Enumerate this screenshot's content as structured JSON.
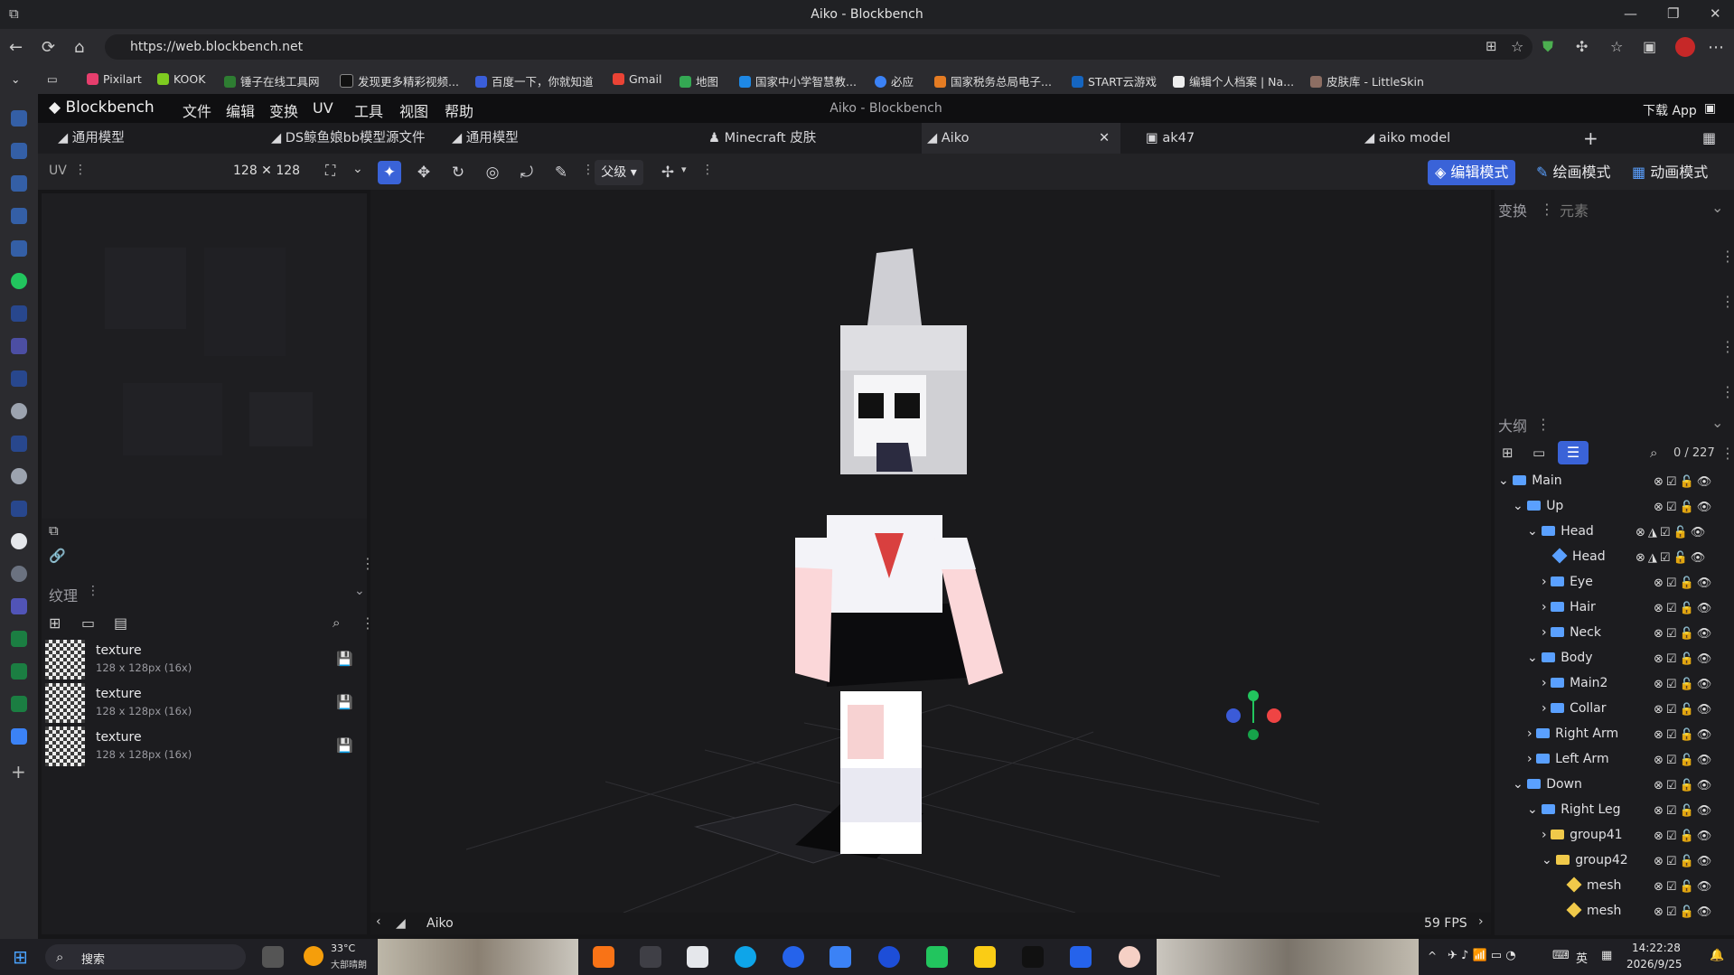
{
  "browser": {
    "window_title": "Aiko - Blockbench",
    "url": "https://web.blockbench.net",
    "bookmarks": [
      "Pixilart",
      "KOOK",
      "锤子在线工具网",
      "发现更多精彩视频...",
      "百度一下，你就知道",
      "Gmail",
      "地图",
      "国家中小学智慧教...",
      "必应",
      "国家税务总局电子...",
      "START云游戏",
      "编辑个人档案 | Na...",
      "皮肤库 - LittleSkin"
    ]
  },
  "menubar": {
    "logo": "Blockbench",
    "items": [
      "文件",
      "编辑",
      "变换",
      "UV",
      "工具",
      "视图",
      "帮助"
    ],
    "center_title": "Aiko - Blockbench",
    "download": "下载 App"
  },
  "tabs": [
    "通用模型",
    "DS鲸鱼娘bb模型源文件",
    "通用模型",
    "Minecraft 皮肤",
    "Aiko",
    "ak47",
    "aiko model"
  ],
  "toolbar": {
    "uv_label": "UV",
    "uv_size": "128 ✕ 128",
    "pivot_select": "父级",
    "modes": [
      "编辑模式",
      "绘画模式",
      "动画模式"
    ]
  },
  "textures": {
    "title": "纹理",
    "items": [
      {
        "name": "texture",
        "meta": "128 x 128px (16x)"
      },
      {
        "name": "texture",
        "meta": "128 x 128px (16x)"
      },
      {
        "name": "texture",
        "meta": "128 x 128px (16x)"
      }
    ]
  },
  "viewport": {
    "model_name": "Aiko",
    "fps": "59 FPS"
  },
  "right": {
    "transform_title": "变换",
    "element_title": "元素",
    "outliner_title": "大纲",
    "count": "0 / 227",
    "rows": [
      {
        "label": "Main",
        "type": "folder"
      },
      {
        "label": "Up",
        "type": "folder"
      },
      {
        "label": "Head",
        "type": "folder"
      },
      {
        "label": "Head",
        "type": "cube"
      },
      {
        "label": "Eye",
        "type": "folder"
      },
      {
        "label": "Hair",
        "type": "folder"
      },
      {
        "label": "Neck",
        "type": "folder"
      },
      {
        "label": "Body",
        "type": "folder"
      },
      {
        "label": "Main2",
        "type": "folder"
      },
      {
        "label": "Collar",
        "type": "folder"
      },
      {
        "label": "Right Arm",
        "type": "folder"
      },
      {
        "label": "Left Arm",
        "type": "folder"
      },
      {
        "label": "Down",
        "type": "folder"
      },
      {
        "label": "Right Leg",
        "type": "folder"
      },
      {
        "label": "group41",
        "type": "folder-y"
      },
      {
        "label": "group42",
        "type": "folder-y"
      },
      {
        "label": "mesh",
        "type": "mesh"
      },
      {
        "label": "mesh",
        "type": "mesh"
      }
    ]
  },
  "taskbar": {
    "search": "搜索",
    "weather_temp": "33°C",
    "weather_desc": "大部晴朗",
    "ime": "英",
    "time": "14:22:28",
    "date": "2026/9/25"
  }
}
